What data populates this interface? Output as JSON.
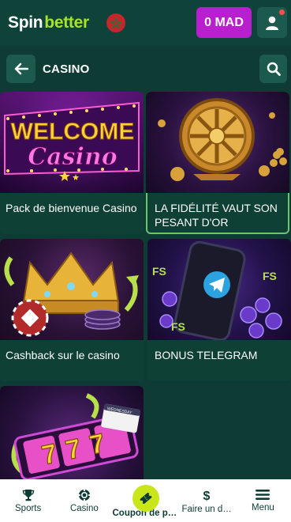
{
  "header": {
    "logo_part1": "Spin",
    "logo_part2": "better",
    "balance": "0 MAD"
  },
  "section": {
    "title": "CASINO"
  },
  "cards": [
    {
      "caption": "Pack de bienvenue Casino",
      "art_text_line1": "WELCOME",
      "art_text_line2": "Casino"
    },
    {
      "caption": "LA FIDÉLITÉ VAUT SON PESANT D'OR"
    },
    {
      "caption": "Cashback sur le casino"
    },
    {
      "caption": "BONUS TELEGRAM",
      "art_badge1": "FS",
      "art_badge2": "FS",
      "art_badge3": "FS"
    },
    {
      "caption": "",
      "art_reel": "777",
      "art_calendar": "WEDNESDAY"
    }
  ],
  "bottom_nav": [
    {
      "label": "Sports",
      "icon": "trophy-icon"
    },
    {
      "label": "Casino",
      "icon": "chip-icon"
    },
    {
      "label": "Coupon de pari",
      "icon": "ticket-icon"
    },
    {
      "label": "Faire un d…",
      "icon": "dollar-icon"
    },
    {
      "label": "Menu",
      "icon": "menu-icon"
    }
  ],
  "colors": {
    "background": "#0e3b33",
    "accent_balance": "#b91fcf",
    "brand_green": "#a6e22e",
    "coupon_yellow": "#c8e61a",
    "selected_outline": "#6cc46c"
  }
}
